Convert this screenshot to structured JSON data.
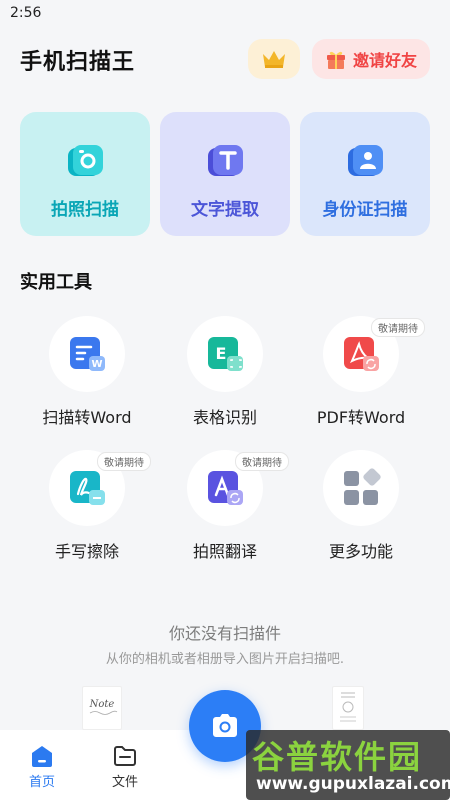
{
  "status_bar": {
    "time": "2:56"
  },
  "header": {
    "title": "手机扫描王",
    "vip_icon": "crown-icon",
    "invite_label": "邀请好友",
    "invite_icon": "gift-icon"
  },
  "feature_cards": [
    {
      "label": "拍照扫描",
      "icon": "camera-scan-icon",
      "color": "#0aa6b6"
    },
    {
      "label": "文字提取",
      "icon": "text-extract-icon",
      "color": "#4c56d8"
    },
    {
      "label": "身份证扫描",
      "icon": "id-card-icon",
      "color": "#2f6fe0"
    }
  ],
  "tools": {
    "title": "实用工具",
    "items": [
      {
        "label": "扫描转Word",
        "icon": "scan-to-word-icon",
        "badge": ""
      },
      {
        "label": "表格识别",
        "icon": "table-recognition-icon",
        "badge": ""
      },
      {
        "label": "PDF转Word",
        "icon": "pdf-to-word-icon",
        "badge": "敬请期待"
      },
      {
        "label": "手写擦除",
        "icon": "handwriting-erase-icon",
        "badge": "敬请期待"
      },
      {
        "label": "拍照翻译",
        "icon": "photo-translate-icon",
        "badge": "敬请期待"
      },
      {
        "label": "更多功能",
        "icon": "more-functions-icon",
        "badge": ""
      }
    ]
  },
  "empty_state": {
    "title": "你还没有扫描件",
    "subtitle": "从你的相机或者相册导入图片开启扫描吧.",
    "note_thumb_text": "Note"
  },
  "tab_bar": {
    "home": "首页",
    "files": "文件"
  },
  "watermark": {
    "main": "谷普软件园",
    "url": "www.gupuxlazai.com"
  },
  "colors": {
    "primary": "#2c7ef6",
    "invite_red": "#f04444",
    "background": "#f5f6f8"
  }
}
